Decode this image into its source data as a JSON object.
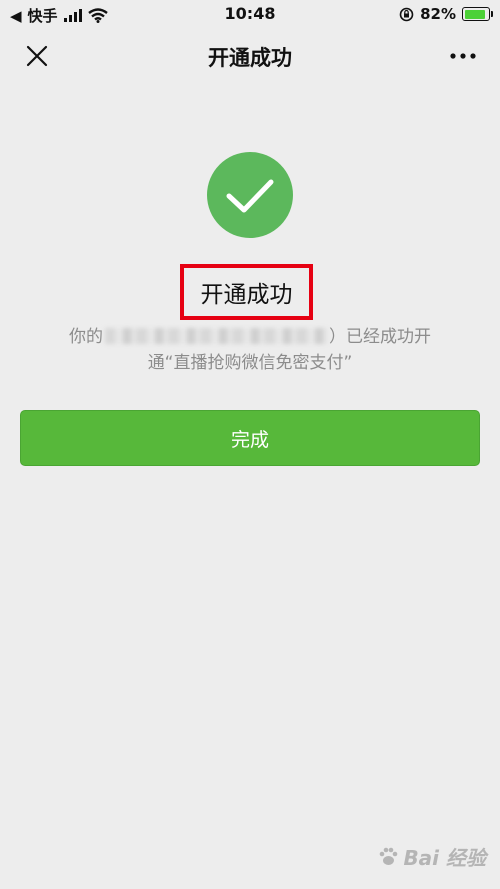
{
  "status_bar": {
    "back_app": "快手",
    "time": "10:48",
    "battery_percent": "82%"
  },
  "nav": {
    "title": "开通成功"
  },
  "result": {
    "title": "开通成功",
    "desc_prefix": "你的",
    "desc_suffix": "）已经成功开",
    "desc_line2": "通“直播抢购微信免密支付”"
  },
  "actions": {
    "done_label": "完成"
  },
  "watermark": {
    "text": "Bai 经验"
  },
  "colors": {
    "background": "#ededed",
    "success_green": "#5cb85c",
    "button_green": "#57b83a",
    "highlight_red": "#e60012"
  }
}
